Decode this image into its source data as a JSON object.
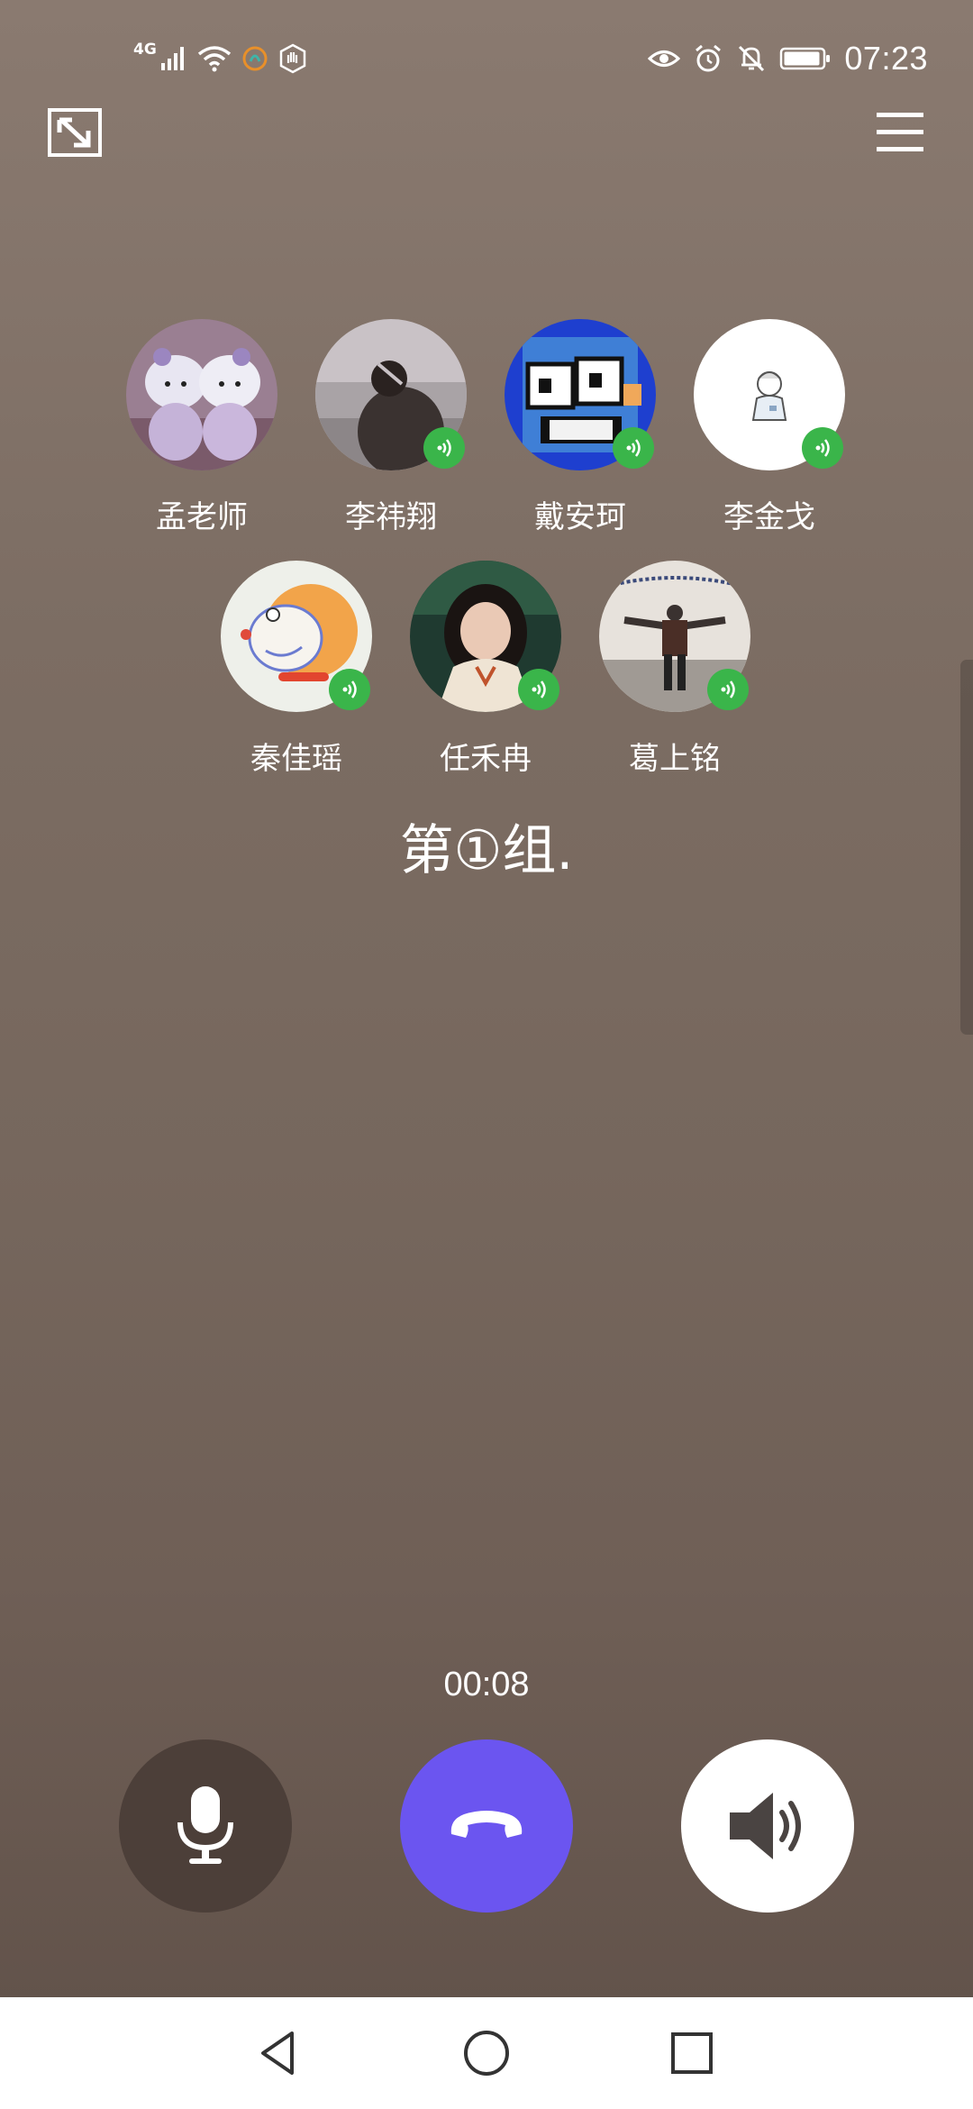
{
  "status_bar": {
    "network_label": "4G",
    "time": "07:23",
    "battery_level": 0.85,
    "icons": [
      "signal-icon",
      "wifi-icon",
      "app-notification-icon",
      "hand-icon",
      "eye-icon",
      "alarm-icon",
      "mute-icon",
      "battery-icon"
    ]
  },
  "top_bar": {
    "minimize_icon": "minimize-window-icon",
    "menu_icon": "menu-icon"
  },
  "participants": [
    {
      "name": "孟老师",
      "speaking": false,
      "avatar": "hello-kitty-avatar"
    },
    {
      "name": "李祎翔",
      "speaking": true,
      "avatar": "person-photo-avatar"
    },
    {
      "name": "戴安珂",
      "speaking": true,
      "avatar": "pixel-face-avatar"
    },
    {
      "name": "李金戈",
      "speaking": true,
      "avatar": "sketch-boy-avatar"
    },
    {
      "name": "秦佳瑶",
      "speaking": true,
      "avatar": "doraemon-avatar"
    },
    {
      "name": "任禾冉",
      "speaking": true,
      "avatar": "girl-photo-avatar"
    },
    {
      "name": "葛上铭",
      "speaking": true,
      "avatar": "person-arms-open-avatar"
    }
  ],
  "group_name": "第①组.",
  "call": {
    "duration": "00:08",
    "mic_icon": "microphone-icon",
    "hangup_icon": "hang-up-icon",
    "speaker_icon": "speaker-icon",
    "colors": {
      "hangup": "#6b55f0",
      "speaking_badge": "#3ab54a"
    }
  },
  "nav": {
    "back_icon": "back-triangle-icon",
    "home_icon": "home-circle-icon",
    "recent_icon": "recent-square-icon"
  }
}
